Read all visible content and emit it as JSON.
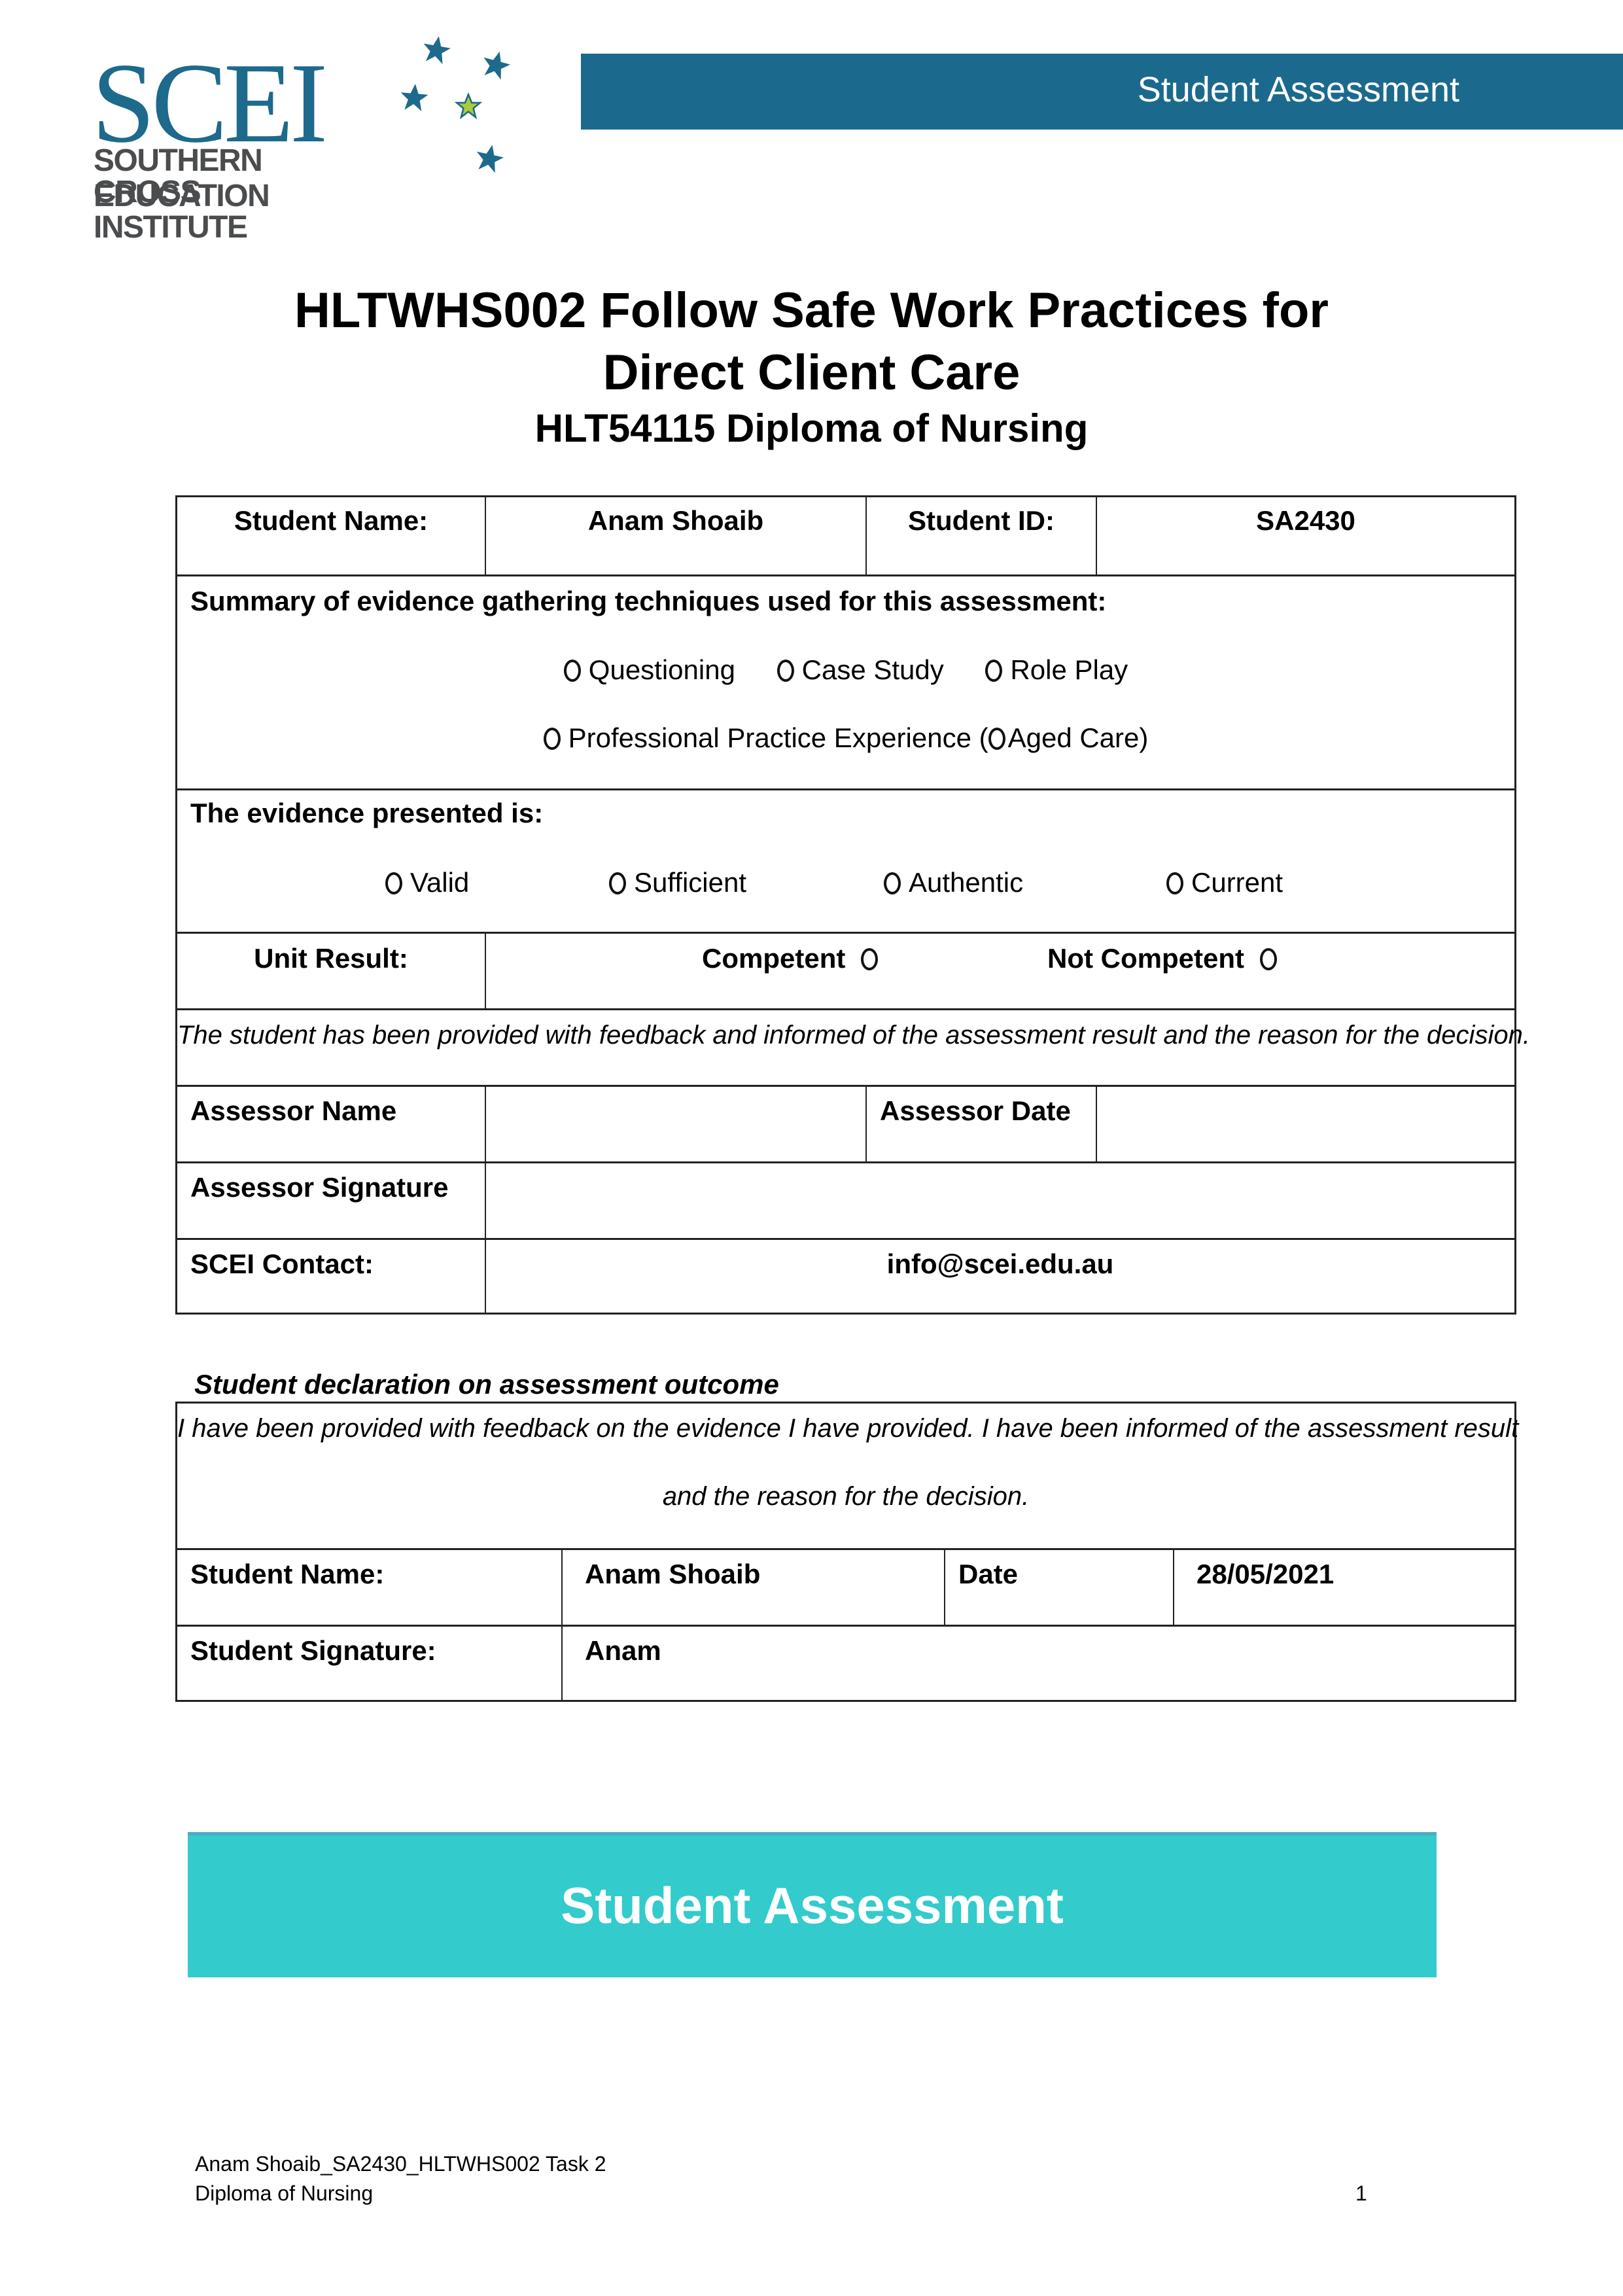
{
  "logo": {
    "mark": "SCEI",
    "line1": "SOUTHERN CROSS",
    "line2": "EDUCATION INSTITUTE",
    "icon": "southern-cross-stars-icon",
    "colors": {
      "primary": "#1d6a8c",
      "accent": "#a8cc3a",
      "text": "#4a4c4e"
    }
  },
  "header": {
    "banner_title": "Student Assessment",
    "banner_color": "#1b6a8e"
  },
  "title": {
    "line1": "HLTWHS002 Follow Safe Work Practices for",
    "line2": "Direct Client Care",
    "subtitle": "HLT54115 Diploma of Nursing"
  },
  "assessment_table": {
    "student_name_label": "Student Name:",
    "student_name_value": "Anam Shoaib",
    "student_id_label": "Student ID:",
    "student_id_value": "SA2430",
    "techniques_heading": "Summary of evidence gathering techniques used for this assessment:",
    "techniques": [
      {
        "label": "Questioning",
        "selected": false
      },
      {
        "label": "Case Study",
        "selected": false
      },
      {
        "label": "Role Play",
        "selected": false
      }
    ],
    "practice_option": {
      "label": "Professional Practice Experience (",
      "selected": false
    },
    "aged_care_option": {
      "label": "Aged Care)",
      "selected": false
    },
    "evidence_heading": "The evidence presented is:",
    "evidence_options": [
      {
        "label": "Valid",
        "selected": false
      },
      {
        "label": "Sufficient",
        "selected": false
      },
      {
        "label": "Authentic",
        "selected": false
      },
      {
        "label": "Current",
        "selected": false
      }
    ],
    "unit_result_label": "Unit Result:",
    "competent_label": "Competent",
    "not_competent_label": "Not Competent",
    "feedback_statement": "The student has been provided with feedback and informed of the assessment result and the reason for the decision.",
    "assessor_name_label": "Assessor Name",
    "assessor_name_value": "",
    "assessor_date_label": "Assessor Date",
    "assessor_date_value": "",
    "assessor_signature_label": "Assessor Signature",
    "assessor_signature_value": "",
    "contact_label": "SCEI Contact:",
    "contact_value": "info@scei.edu.au"
  },
  "declaration": {
    "heading": "Student declaration on assessment outcome",
    "statement_line1": "I have been provided with feedback on the evidence I have provided. I have been informed of the assessment result",
    "statement_line2": "and the reason for the decision.",
    "student_name_label": "Student Name:",
    "student_name_value": "Anam Shoaib",
    "date_label": "Date",
    "date_value": "28/05/2021",
    "signature_label": "Student Signature:",
    "signature_value": "Anam"
  },
  "section_banner": {
    "title": "Student Assessment",
    "color": "#33cbcb"
  },
  "footer": {
    "line1": "Anam Shoaib_SA2430_HLTWHS002 Task 2",
    "line2": "Diploma of Nursing",
    "page_number": "1"
  }
}
